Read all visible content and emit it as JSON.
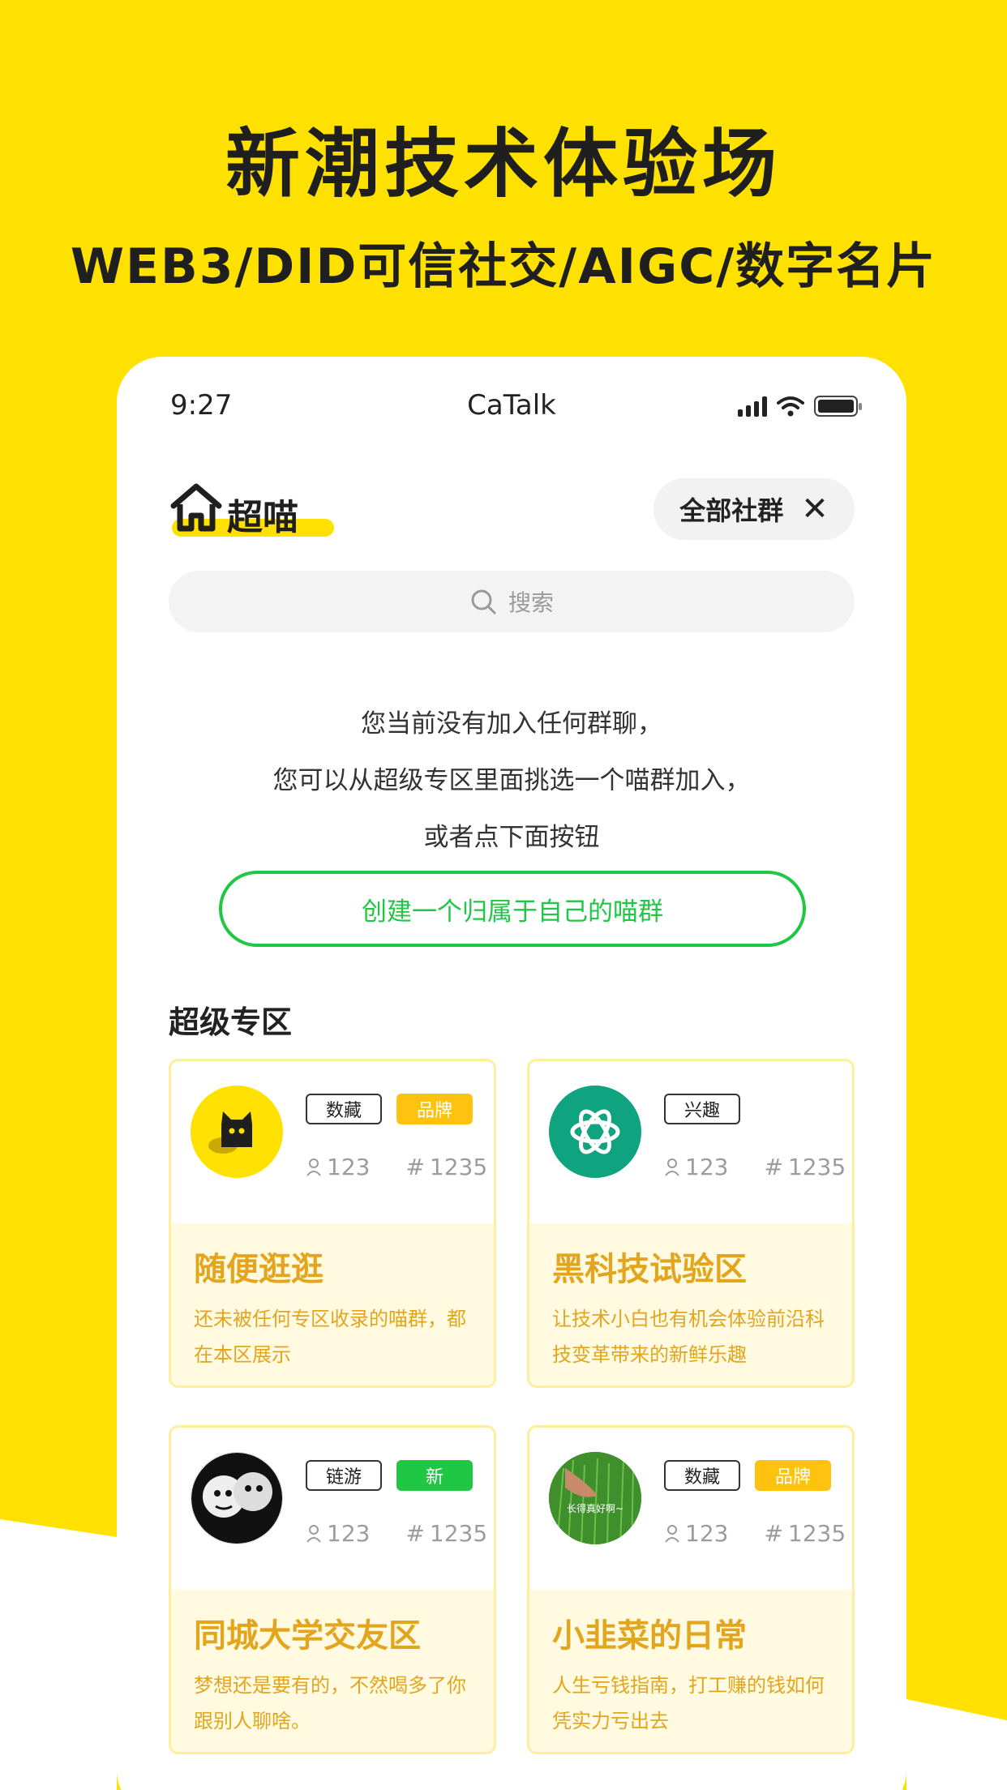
{
  "promo": {
    "headline": "新潮技术体验场",
    "subline": "WEB3/DID可信社交/AIGC/数字名片"
  },
  "status_bar": {
    "time": "9:27",
    "app_name": "CaTalk"
  },
  "header": {
    "logo_text": "超喵",
    "filter_label": "全部社群"
  },
  "search": {
    "placeholder": "搜索"
  },
  "empty_state": {
    "line1": "您当前没有加入任何群聊，",
    "line2": "您可以从超级专区里面挑选一个喵群加入，",
    "line3": "或者点下面按钮"
  },
  "create_button": "创建一个归属于自己的喵群",
  "section_title": "超级专区",
  "zones": [
    {
      "name": "随便逛逛",
      "desc": "还未被任何专区收录的喵群，都在本区展示",
      "tags": [
        {
          "label": "数藏",
          "style": "outline"
        },
        {
          "label": "品牌",
          "style": "brand"
        }
      ],
      "members": "123",
      "posts": "1235",
      "avatar_icon": "black-cat-icon"
    },
    {
      "name": "黑科技试验区",
      "desc": "让技术小白也有机会体验前沿科技变革带来的新鲜乐趣",
      "tags": [
        {
          "label": "兴趣",
          "style": "outline"
        }
      ],
      "members": "123",
      "posts": "1235",
      "avatar_icon": "openai-logo-icon"
    },
    {
      "name": "同城大学交友区",
      "desc": "梦想还是要有的，不然喝多了你跟别人聊啥。",
      "tags": [
        {
          "label": "链游",
          "style": "outline"
        },
        {
          "label": "新",
          "style": "new"
        }
      ],
      "members": "123",
      "posts": "1235",
      "avatar_icon": "panda-meme-icon"
    },
    {
      "name": "小韭菜的日常",
      "desc": "人生亏钱指南，打工赚的钱如何凭实力亏出去",
      "tags": [
        {
          "label": "数藏",
          "style": "outline"
        },
        {
          "label": "品牌",
          "style": "brand"
        }
      ],
      "members": "123",
      "posts": "1235",
      "avatar_icon": "grass-photo-icon",
      "avatar_caption": "长得真好啊~"
    }
  ],
  "colors": {
    "brand_yellow": "#FFE100",
    "accent_green": "#20C744",
    "zone_text": "#E3A51E",
    "brand_tag": "#FFC20E"
  }
}
